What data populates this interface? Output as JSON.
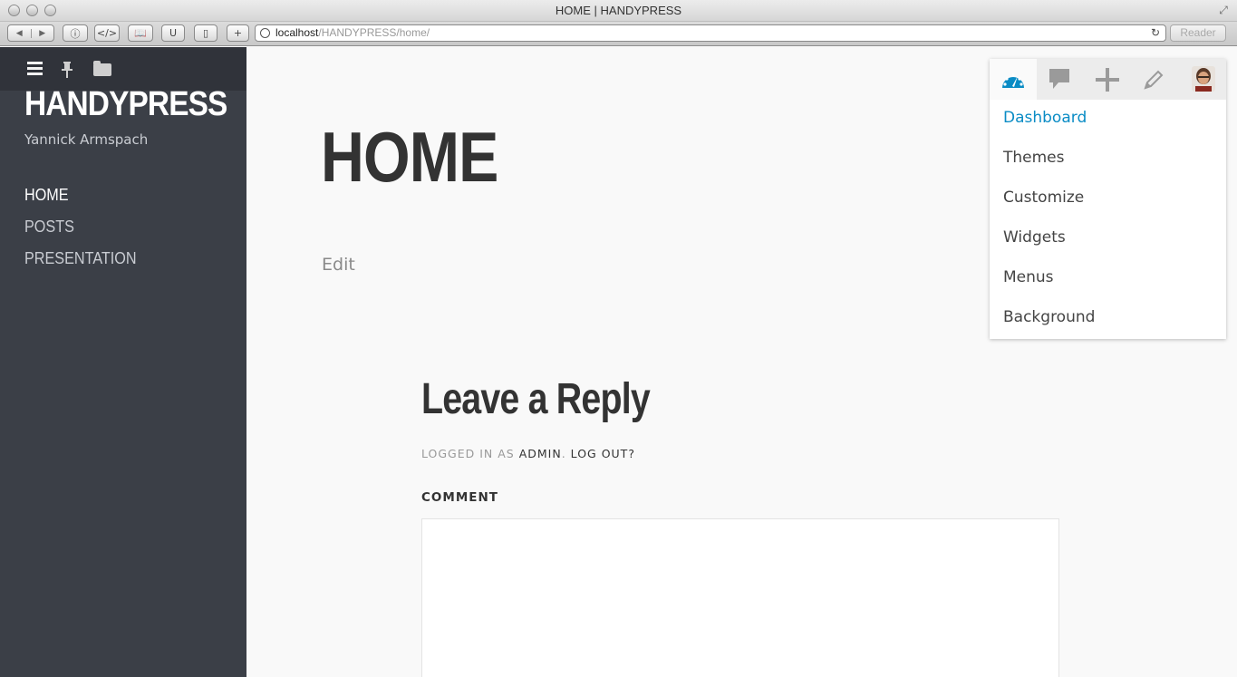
{
  "window": {
    "title": "HOME | HANDYPRESS"
  },
  "browser": {
    "url_host": "localhost",
    "url_path": "/HANDYPRESS/home/",
    "reader_label": "Reader"
  },
  "sidebar": {
    "site_title": "HANDYPRESS",
    "site_subtitle": "Yannick Armspach",
    "nav": [
      {
        "label": "HOME",
        "active": true
      },
      {
        "label": "POSTS",
        "active": false
      },
      {
        "label": "PRESENTATION",
        "active": false
      }
    ]
  },
  "main": {
    "page_title": "HOME",
    "edit_label": "Edit",
    "reply_title": "Leave a Reply",
    "logged_in_prefix": "LOGGED IN AS",
    "logged_in_user": "ADMIN",
    "logout_label": "LOG OUT?",
    "comment_label": "COMMENT"
  },
  "admin_panel": {
    "icons": [
      "dashboard-icon",
      "comment-icon",
      "plus-icon",
      "pencil-icon",
      "avatar"
    ],
    "menu": [
      {
        "label": "Dashboard",
        "current": true
      },
      {
        "label": "Themes"
      },
      {
        "label": "Customize"
      },
      {
        "label": "Widgets"
      },
      {
        "label": "Menus"
      },
      {
        "label": "Background"
      }
    ],
    "accent_color": "#0a8cc5"
  },
  "colors": {
    "sidebar_bg": "#3b3f47",
    "sidebar_top_bg": "#30333a",
    "page_bg": "#f9f9f9"
  }
}
